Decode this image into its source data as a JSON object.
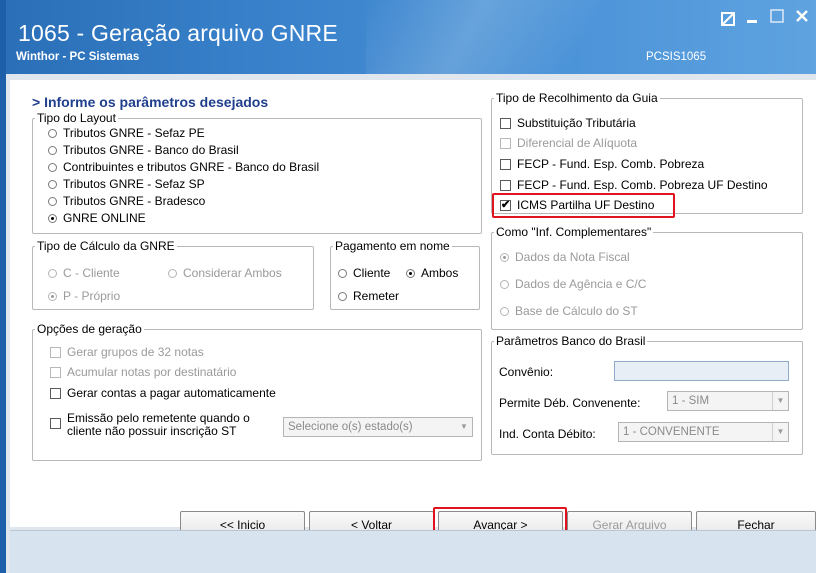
{
  "window": {
    "title": "1065 - Geração arquivo GNRE",
    "subtitle": "Winthor - PC Sistemas",
    "code": "PCSIS1065"
  },
  "heading": "> Informe os parâmetros desejados",
  "layout_group": {
    "legend": "Tipo do Layout",
    "options": [
      {
        "label": "Tributos GNRE - Sefaz PE",
        "selected": false
      },
      {
        "label": "Tributos GNRE - Banco do Brasil",
        "selected": false
      },
      {
        "label": "Contribuintes e tributos GNRE - Banco do Brasil",
        "selected": false
      },
      {
        "label": "Tributos GNRE - Sefaz SP",
        "selected": false
      },
      {
        "label": "Tributos GNRE - Bradesco",
        "selected": false
      },
      {
        "label": "GNRE ONLINE",
        "selected": true
      }
    ]
  },
  "calc_group": {
    "legend": "Tipo de Cálculo da GNRE",
    "options": [
      {
        "label": "C - Cliente",
        "selected": false
      },
      {
        "label": "Considerar Ambos",
        "selected": false
      },
      {
        "label": "P - Próprio",
        "selected": true
      }
    ]
  },
  "payment_group": {
    "legend": "Pagamento em nome",
    "options": [
      {
        "label": "Cliente",
        "selected": false
      },
      {
        "label": "Ambos",
        "selected": true
      },
      {
        "label": "Remeter",
        "selected": false
      }
    ]
  },
  "generation_group": {
    "legend": "Opções de geração",
    "options": [
      {
        "label": "Gerar grupos de 32 notas",
        "checked": false,
        "enabled": false
      },
      {
        "label": "Acumular notas por destinatário",
        "checked": false,
        "enabled": false
      },
      {
        "label": "Gerar contas a pagar automaticamente",
        "checked": false,
        "enabled": true
      },
      {
        "label": "Emissão pelo remetente quando o",
        "label2": "cliente não possuir inscrição ST",
        "checked": false,
        "enabled": true
      }
    ],
    "states_select": "Selecione o(s) estado(s)"
  },
  "collection_group": {
    "legend": "Tipo de Recolhimento da Guia",
    "options": [
      {
        "label": "Substituição Tributária",
        "checked": false,
        "enabled": true
      },
      {
        "label": "Diferencial de Alíquota",
        "checked": false,
        "enabled": false
      },
      {
        "label": "FECP - Fund. Esp. Comb. Pobreza",
        "checked": false,
        "enabled": true
      },
      {
        "label": "FECP - Fund. Esp. Comb. Pobreza UF Destino",
        "checked": false,
        "enabled": true
      },
      {
        "label": "ICMS Partilha UF Destino",
        "checked": true,
        "enabled": true
      }
    ],
    "check_mark": "✔"
  },
  "info_group": {
    "legend": "Como \"Inf. Complementares\"",
    "options": [
      {
        "label": "Dados da Nota Fiscal",
        "selected": true
      },
      {
        "label": "Dados de Agência e C/C",
        "selected": false
      },
      {
        "label": "Base de Cálculo do ST",
        "selected": false
      }
    ]
  },
  "bb_group": {
    "legend": "Parâmetros Banco do Brasil",
    "convenio_label": "Convênio:",
    "convenio_value": "",
    "permite_label": "Permite Déb. Convenente:",
    "permite_value": "1 - SIM",
    "ind_label": "Ind. Conta Débito:",
    "ind_value": "1 - CONVENENTE"
  },
  "buttons": {
    "inicio": "<< Inicio",
    "voltar": "< Voltar",
    "avancar": "Avançar >",
    "gerar": "Gerar Arquivo",
    "fechar": "Fechar"
  },
  "colors": {
    "titlebar": "#3a83cc",
    "highlight": "#e0141e",
    "heading": "#1f3e8c"
  }
}
